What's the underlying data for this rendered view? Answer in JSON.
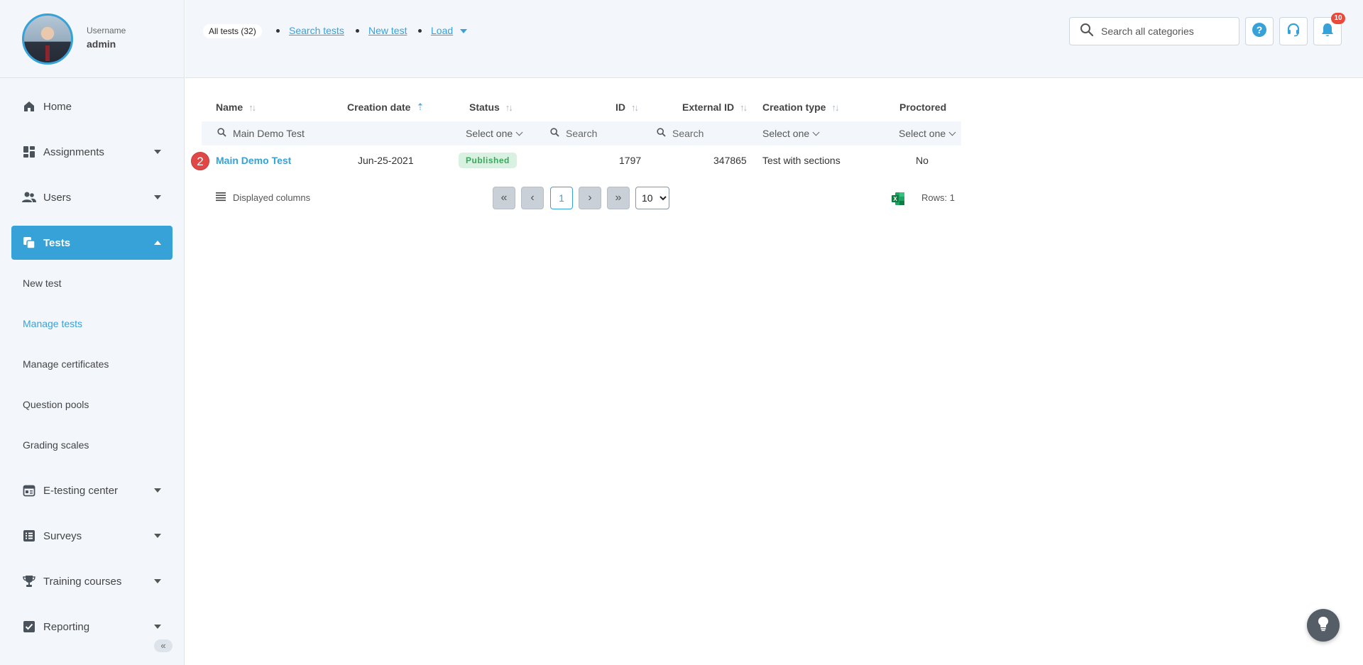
{
  "profile": {
    "label": "Username",
    "name": "admin"
  },
  "header": {
    "all_tests": "All tests (32)",
    "links": {
      "search_tests": "Search tests",
      "new_test": "New test",
      "load": "Load"
    },
    "search_placeholder": "Search all categories",
    "notification_count": "10"
  },
  "sidebar": {
    "home": "Home",
    "assignments": "Assignments",
    "users": "Users",
    "tests": "Tests",
    "sub": {
      "new_test": "New test",
      "manage_tests": "Manage tests",
      "manage_certificates": "Manage certificates",
      "question_pools": "Question pools",
      "grading_scales": "Grading scales"
    },
    "e_testing": "E-testing center",
    "surveys": "Surveys",
    "training": "Training courses",
    "reporting": "Reporting"
  },
  "table": {
    "columns": {
      "name": "Name",
      "creation_date": "Creation date",
      "status": "Status",
      "id": "ID",
      "external_id": "External ID",
      "creation_type": "Creation type",
      "proctored": "Proctored"
    },
    "filters": {
      "name_value": "Main Demo Test",
      "status": "Select one",
      "id_placeholder": "Search",
      "external_id_placeholder": "Search",
      "creation_type": "Select one",
      "proctored": "Select one"
    },
    "rows": [
      {
        "step": "2",
        "name": "Main Demo Test",
        "creation_date": "Jun-25-2021",
        "status": "Published",
        "id": "1797",
        "external_id": "347865",
        "creation_type": "Test with sections",
        "proctored": "No"
      }
    ],
    "footer": {
      "displayed_columns": "Displayed columns",
      "current_page": "1",
      "page_size": "10",
      "rows_label": "Rows: 1"
    }
  },
  "colors": {
    "accent": "#36a2d8",
    "published_bg": "#d8f1e0",
    "published_text": "#39a85c",
    "badge": "#e84b3c"
  }
}
